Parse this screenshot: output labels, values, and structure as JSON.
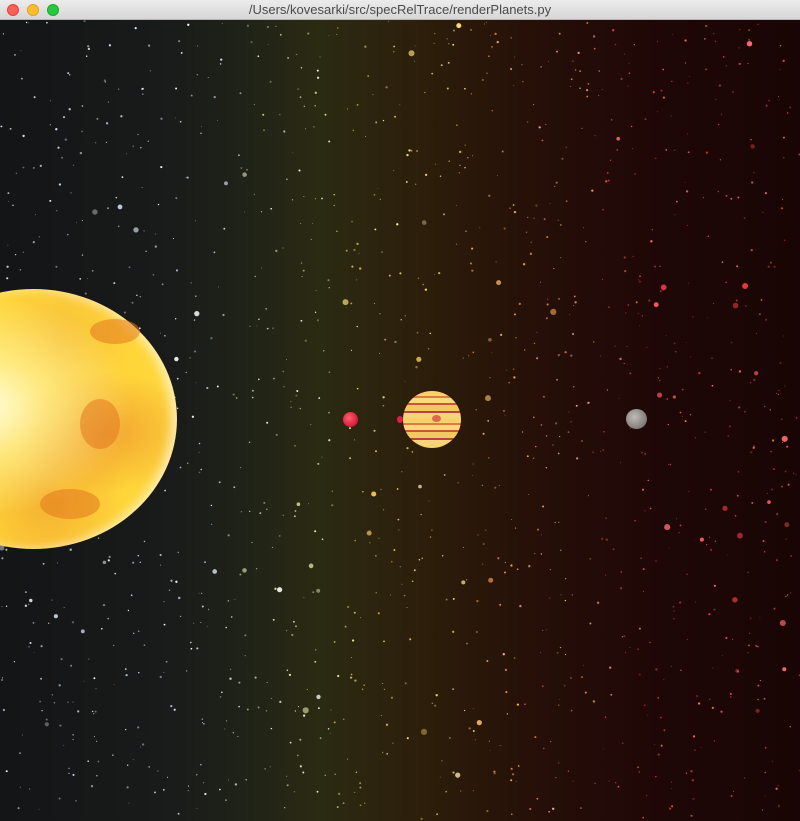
{
  "window": {
    "title": "/Users/kovesarki/src/specRelTrace/renderPlanets.py",
    "buttons": [
      {
        "name": "close",
        "color": "#fe5f57"
      },
      {
        "name": "minimize",
        "color": "#febc2e"
      },
      {
        "name": "zoom",
        "color": "#28c840"
      }
    ]
  },
  "scene": {
    "objects": [
      "sun",
      "mars",
      "small-moon",
      "jupiter",
      "grey-moon"
    ]
  }
}
